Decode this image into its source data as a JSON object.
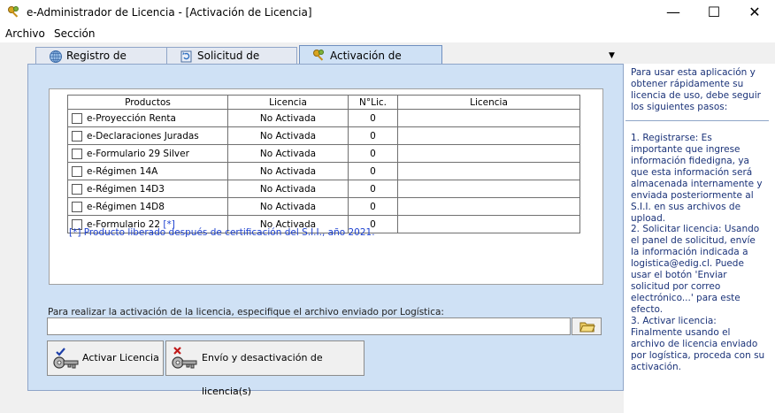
{
  "window": {
    "title": "e-Administrador de Licencia - [Activación de Licencia]",
    "controls": [
      "—",
      "☐",
      "✕"
    ]
  },
  "menu": [
    "Archivo",
    "Sección"
  ],
  "tabs": [
    {
      "label": "Registro de usuario"
    },
    {
      "label": "Solicitud de licencia"
    },
    {
      "label": "Activación de Licencia"
    }
  ],
  "table": {
    "headers": [
      "Productos",
      "Licencia",
      "N°Lic.",
      "Licencia"
    ],
    "rows": [
      {
        "product": "e-Proyección Renta",
        "mark": "",
        "status": "No Activada",
        "num": "0",
        "license": ""
      },
      {
        "product": "e-Declaraciones Juradas",
        "mark": "",
        "status": "No Activada",
        "num": "0",
        "license": ""
      },
      {
        "product": "e-Formulario 29 Silver",
        "mark": "",
        "status": "No Activada",
        "num": "0",
        "license": ""
      },
      {
        "product": "e-Régimen 14A",
        "mark": "",
        "status": "No Activada",
        "num": "0",
        "license": ""
      },
      {
        "product": "e-Régimen 14D3",
        "mark": "",
        "status": "No Activada",
        "num": "0",
        "license": ""
      },
      {
        "product": "e-Régimen 14D8",
        "mark": "",
        "status": "No Activada",
        "num": "0",
        "license": ""
      },
      {
        "product": "e-Formulario 22 ",
        "mark": "[*]",
        "status": "No Activada",
        "num": "0",
        "license": ""
      }
    ],
    "note": "[*]  Producto liberado después de certificación del S.I.I., año 2021."
  },
  "file": {
    "label": "Para realizar la activación de la licencia, especifique el archivo enviado por Logística:",
    "value": ""
  },
  "buttons": {
    "activar": "Activar Licencia",
    "envio": "Envío y desactivación de licencia(s)"
  },
  "help": {
    "intro": "Para usar esta aplicación y obtener rápidamente su licencia de uso, debe seguir los siguientes pasos:",
    "step1": "1. Registrarse: Es importante que ingrese información fidedigna, ya que esta información será almacenada internamente y enviada posteriormente al S.I.I. en sus archivos de upload.",
    "step2": "2. Solicitar licencia: Usando el panel de solicitud, envíe la información indicada a logistica@edig.cl. Puede usar el botón 'Enviar solicitud por correo electrónico...' para este efecto.",
    "step3": "3. Activar licencia: Finalmente usando el archivo de licencia enviado por logística, proceda con su activación."
  },
  "colors": {
    "panel": "#cfe1f5",
    "help_text": "#1a3278",
    "note_text": "#1a3fcf"
  }
}
